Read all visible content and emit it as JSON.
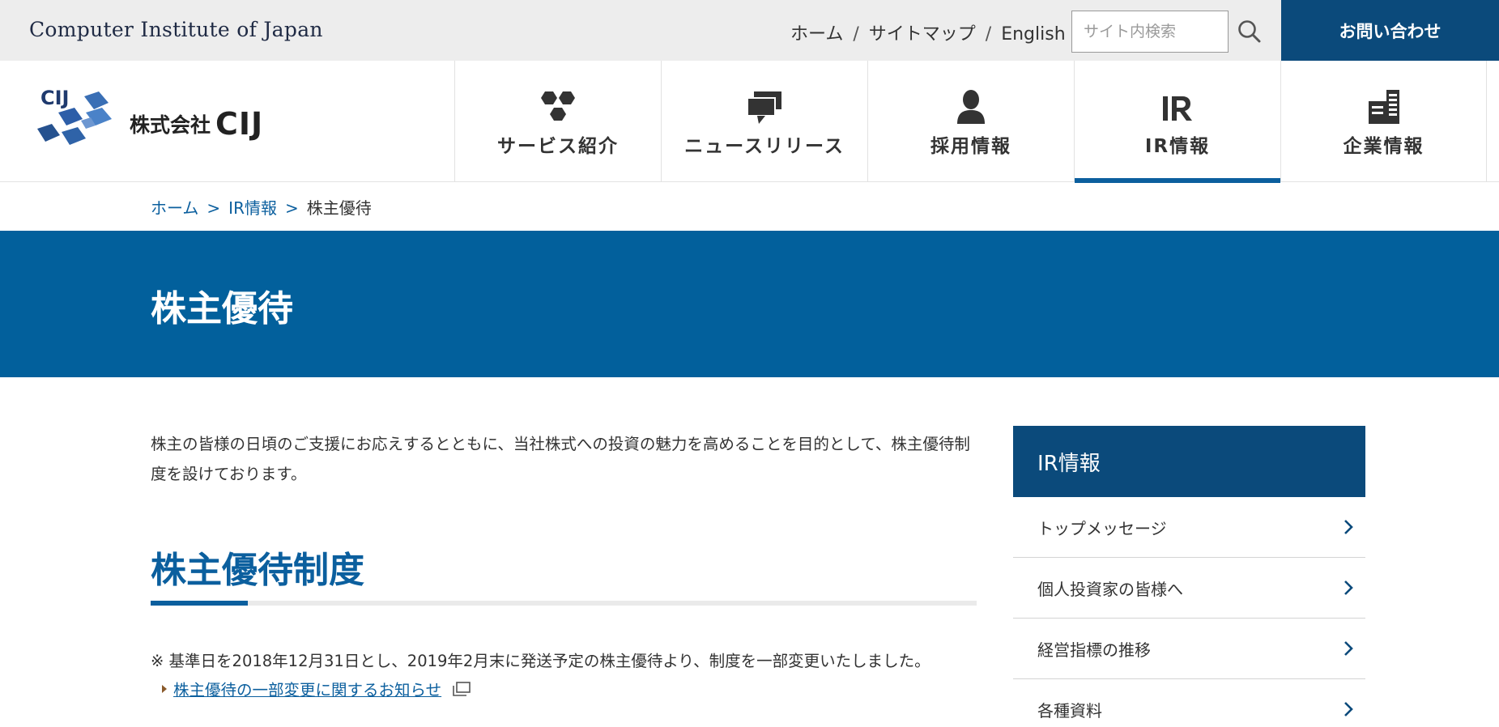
{
  "topbar": {
    "corp_name": "Computer Institute of Japan",
    "links": [
      "ホーム",
      "サイトマップ",
      "English"
    ],
    "search_placeholder": "サイト内検索",
    "contact_label": "お問い合わせ"
  },
  "logo": {
    "mark_text": "CIJ",
    "company_prefix": "株式会社",
    "company_name": "CIJ"
  },
  "nav": {
    "items": [
      {
        "label": "サービス紹介",
        "icon": "hexagons-icon"
      },
      {
        "label": "ニュースリリース",
        "icon": "speech-bubbles-icon"
      },
      {
        "label": "採用情報",
        "icon": "person-icon"
      },
      {
        "label": "IR情報",
        "icon": "ir-icon",
        "active": true
      },
      {
        "label": "企業情報",
        "icon": "building-icon"
      }
    ]
  },
  "breadcrumb": {
    "home": "ホーム",
    "sep": ">",
    "parent": "IR情報",
    "current": "株主優待"
  },
  "hero": {
    "title": "株主優待"
  },
  "content": {
    "intro": "株主の皆様の日頃のご支援にお応えするとともに、当社株式への投資の魅力を高めることを目的として、株主優待制度を設けております。",
    "section_title": "株主優待制度",
    "notice": "※ 基準日を2018年12月31日とし、2019年2月末に発送予定の株主優待より、制度を一部変更いたしました。",
    "notice_link": "株主優待の一部変更に関するお知らせ"
  },
  "sidebar": {
    "title": "IR情報",
    "items": [
      "トップメッセージ",
      "個人投資家の皆様へ",
      "経営指標の推移",
      "各種資料"
    ]
  },
  "colors": {
    "brand_dark": "#0b4a7b",
    "brand_blue": "#02609c",
    "link_blue": "#0b5f9e",
    "topbar_bg": "#ededed"
  }
}
